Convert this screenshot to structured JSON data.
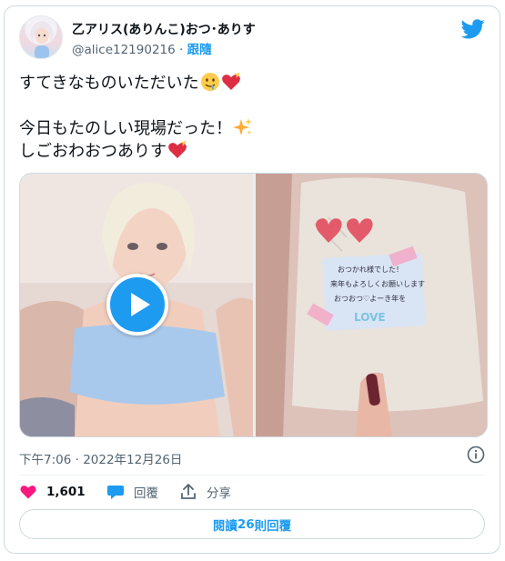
{
  "author": {
    "display_name": "乙アリス(ありんこ)おつ･ありす",
    "handle": "@alice12190216",
    "separator": " · ",
    "follow_label": "跟隨"
  },
  "tweet": {
    "line1": "すてきなものいただいた",
    "line2": "今日もたのしい現場だった！",
    "line3": "しごおわおつありす",
    "emojis": {
      "line1": [
        "drooling-face-icon",
        "heart-with-ribbon-icon"
      ],
      "line2": [
        "sparkles-icon"
      ],
      "line3": [
        "heart-with-ribbon-icon"
      ]
    }
  },
  "media": {
    "left": "video-thumbnail",
    "right": "gift-bag-photo",
    "gift_card_lines": [
      "おつかれ様でした！",
      "来年もよろしくお願いします",
      "おつおつ♡よーき年を",
      "LOVE"
    ]
  },
  "meta": {
    "time": "下午7:06",
    "separator": " · ",
    "date": "2022年12月26日"
  },
  "actions": {
    "like_count": "1,601",
    "reply_label": "回覆",
    "share_label": "分享"
  },
  "footer": {
    "read_label_prefix": "閱讀 ",
    "reply_count": "26",
    "read_label_suffix": " 則回覆"
  },
  "colors": {
    "accent": "#1d9bf0",
    "heart": "#f91880",
    "text": "#0f1419",
    "muted": "#536471",
    "border": "#cfd9de"
  }
}
